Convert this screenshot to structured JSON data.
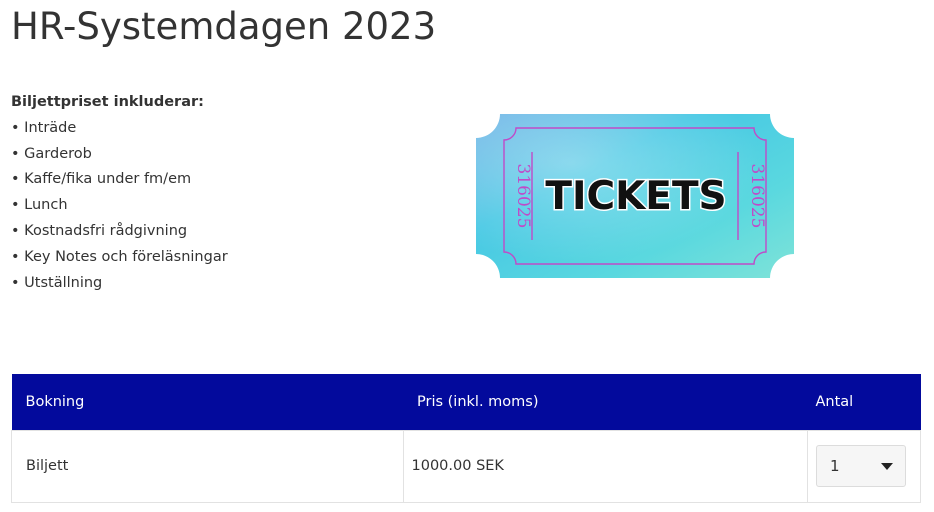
{
  "page": {
    "title": "HR-Systemdagen 2023"
  },
  "includes": {
    "heading": "Biljettpriset inkluderar:",
    "items": [
      "Inträde",
      "Garderob",
      "Kaffe/fika under fm/em",
      "Lunch",
      "Kostnadsfri rådgivning",
      "Key Notes och föreläsningar",
      "Utställning"
    ]
  },
  "ticket_image": {
    "text": "TICKETS",
    "serial": "316025",
    "icon": "ticket-icon"
  },
  "table": {
    "headers": {
      "booking": "Bokning",
      "price": "Pris (inkl. moms)",
      "quantity": "Antal"
    },
    "rows": [
      {
        "booking": "Biljett",
        "price": "1000.00 SEK",
        "quantity": "1"
      }
    ]
  },
  "colors": {
    "header_bg": "#030a9c",
    "ticket_cyan": "#4fd3e0",
    "ticket_border": "#c04ac8"
  }
}
